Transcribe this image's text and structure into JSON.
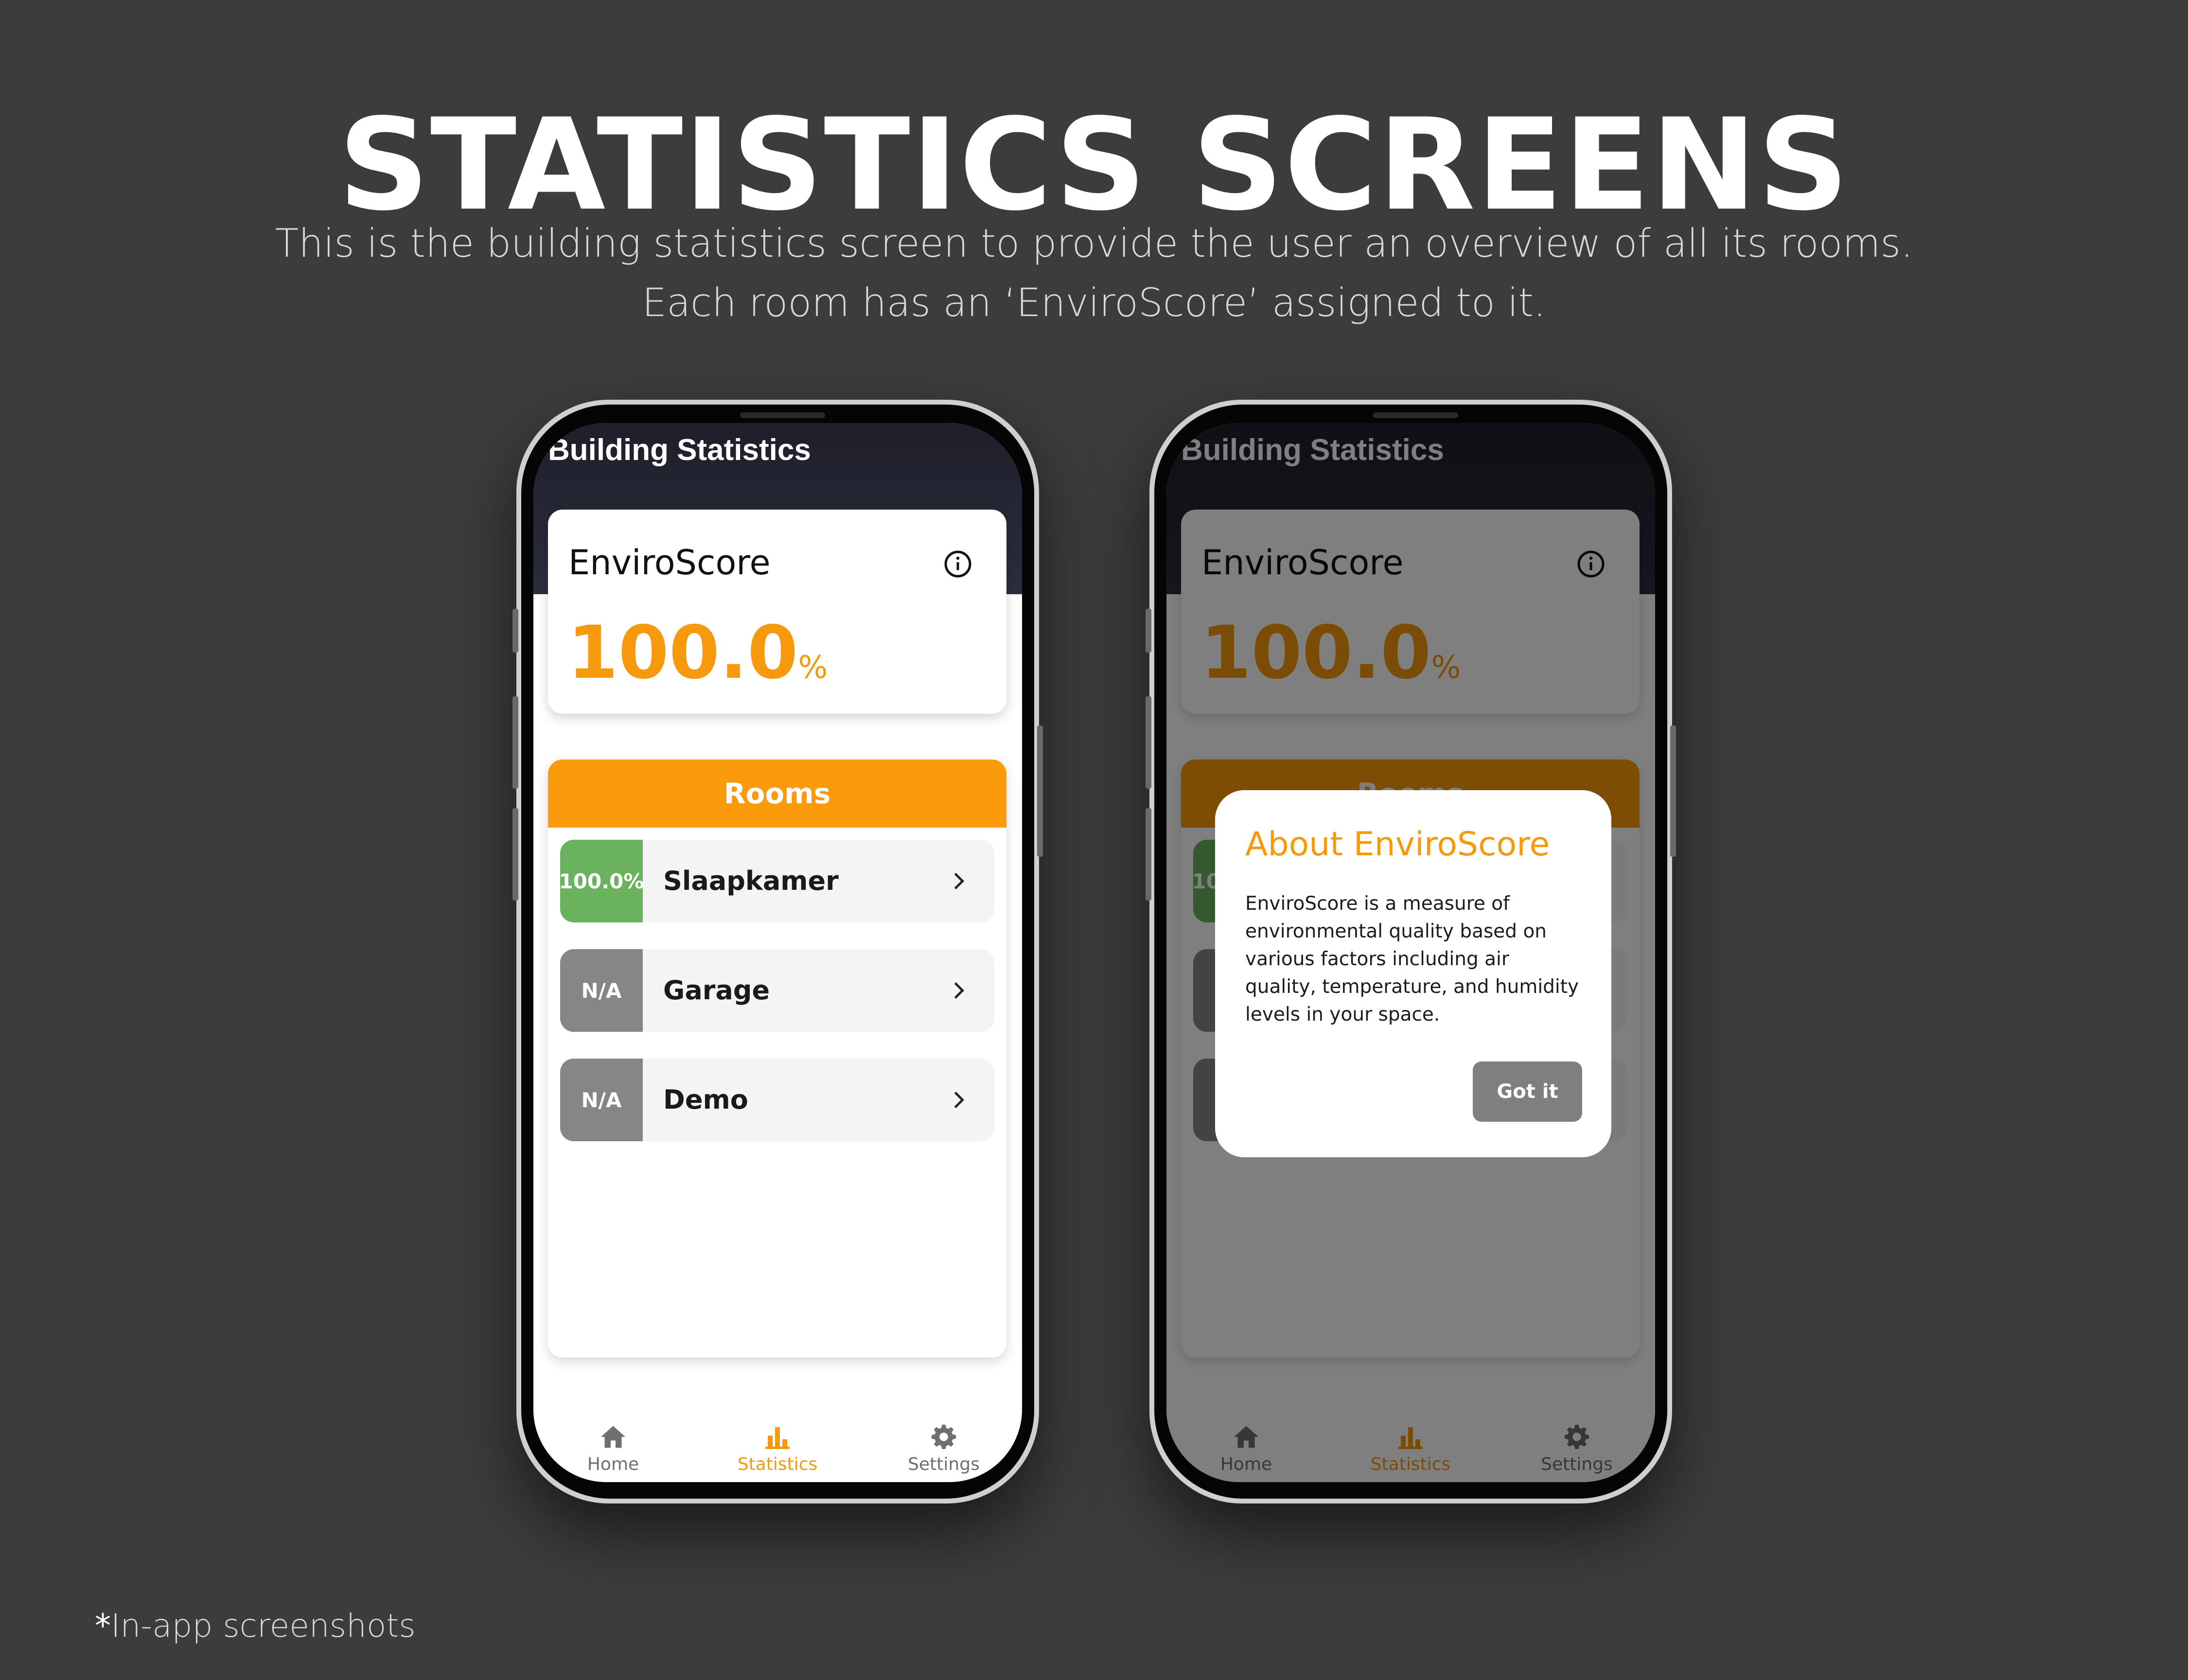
{
  "headline": "STATISTICS SCREENS",
  "subtitle_lines": [
    "This is the building statistics screen to provide the user an overview of all its rooms.",
    "Each room has an ‘EnviroScore’ assigned to it."
  ],
  "footnote": {
    "asterisk": "*",
    "text": "In-app screenshots"
  },
  "colors": {
    "accent": "#f7990c",
    "good": "#6bb25f",
    "na": "#868686",
    "background": "#3c3c3c"
  },
  "app": {
    "title": "Building Statistics",
    "score_card": {
      "label": "EnviroScore",
      "info_icon": "info-icon",
      "value": "100.0",
      "unit": "%"
    },
    "rooms_header": "Rooms",
    "rooms": [
      {
        "badge": "100.0%",
        "name": "Slaapkamer",
        "status": "good"
      },
      {
        "badge": "N/A",
        "name": "Garage",
        "status": "na"
      },
      {
        "badge": "N/A",
        "name": "Demo",
        "status": "na"
      }
    ],
    "nav": [
      {
        "label": "Home",
        "icon": "home-icon",
        "active": false
      },
      {
        "label": "Statistics",
        "icon": "bar-chart-icon",
        "active": true
      },
      {
        "label": "Settings",
        "icon": "gear-icon",
        "active": false
      }
    ]
  },
  "dialog": {
    "title": "About EnviroScore",
    "body": "EnviroScore is a measure of environmental quality based on various factors including air quality, temperature, and humidity levels in your space.",
    "button": "Got it"
  }
}
